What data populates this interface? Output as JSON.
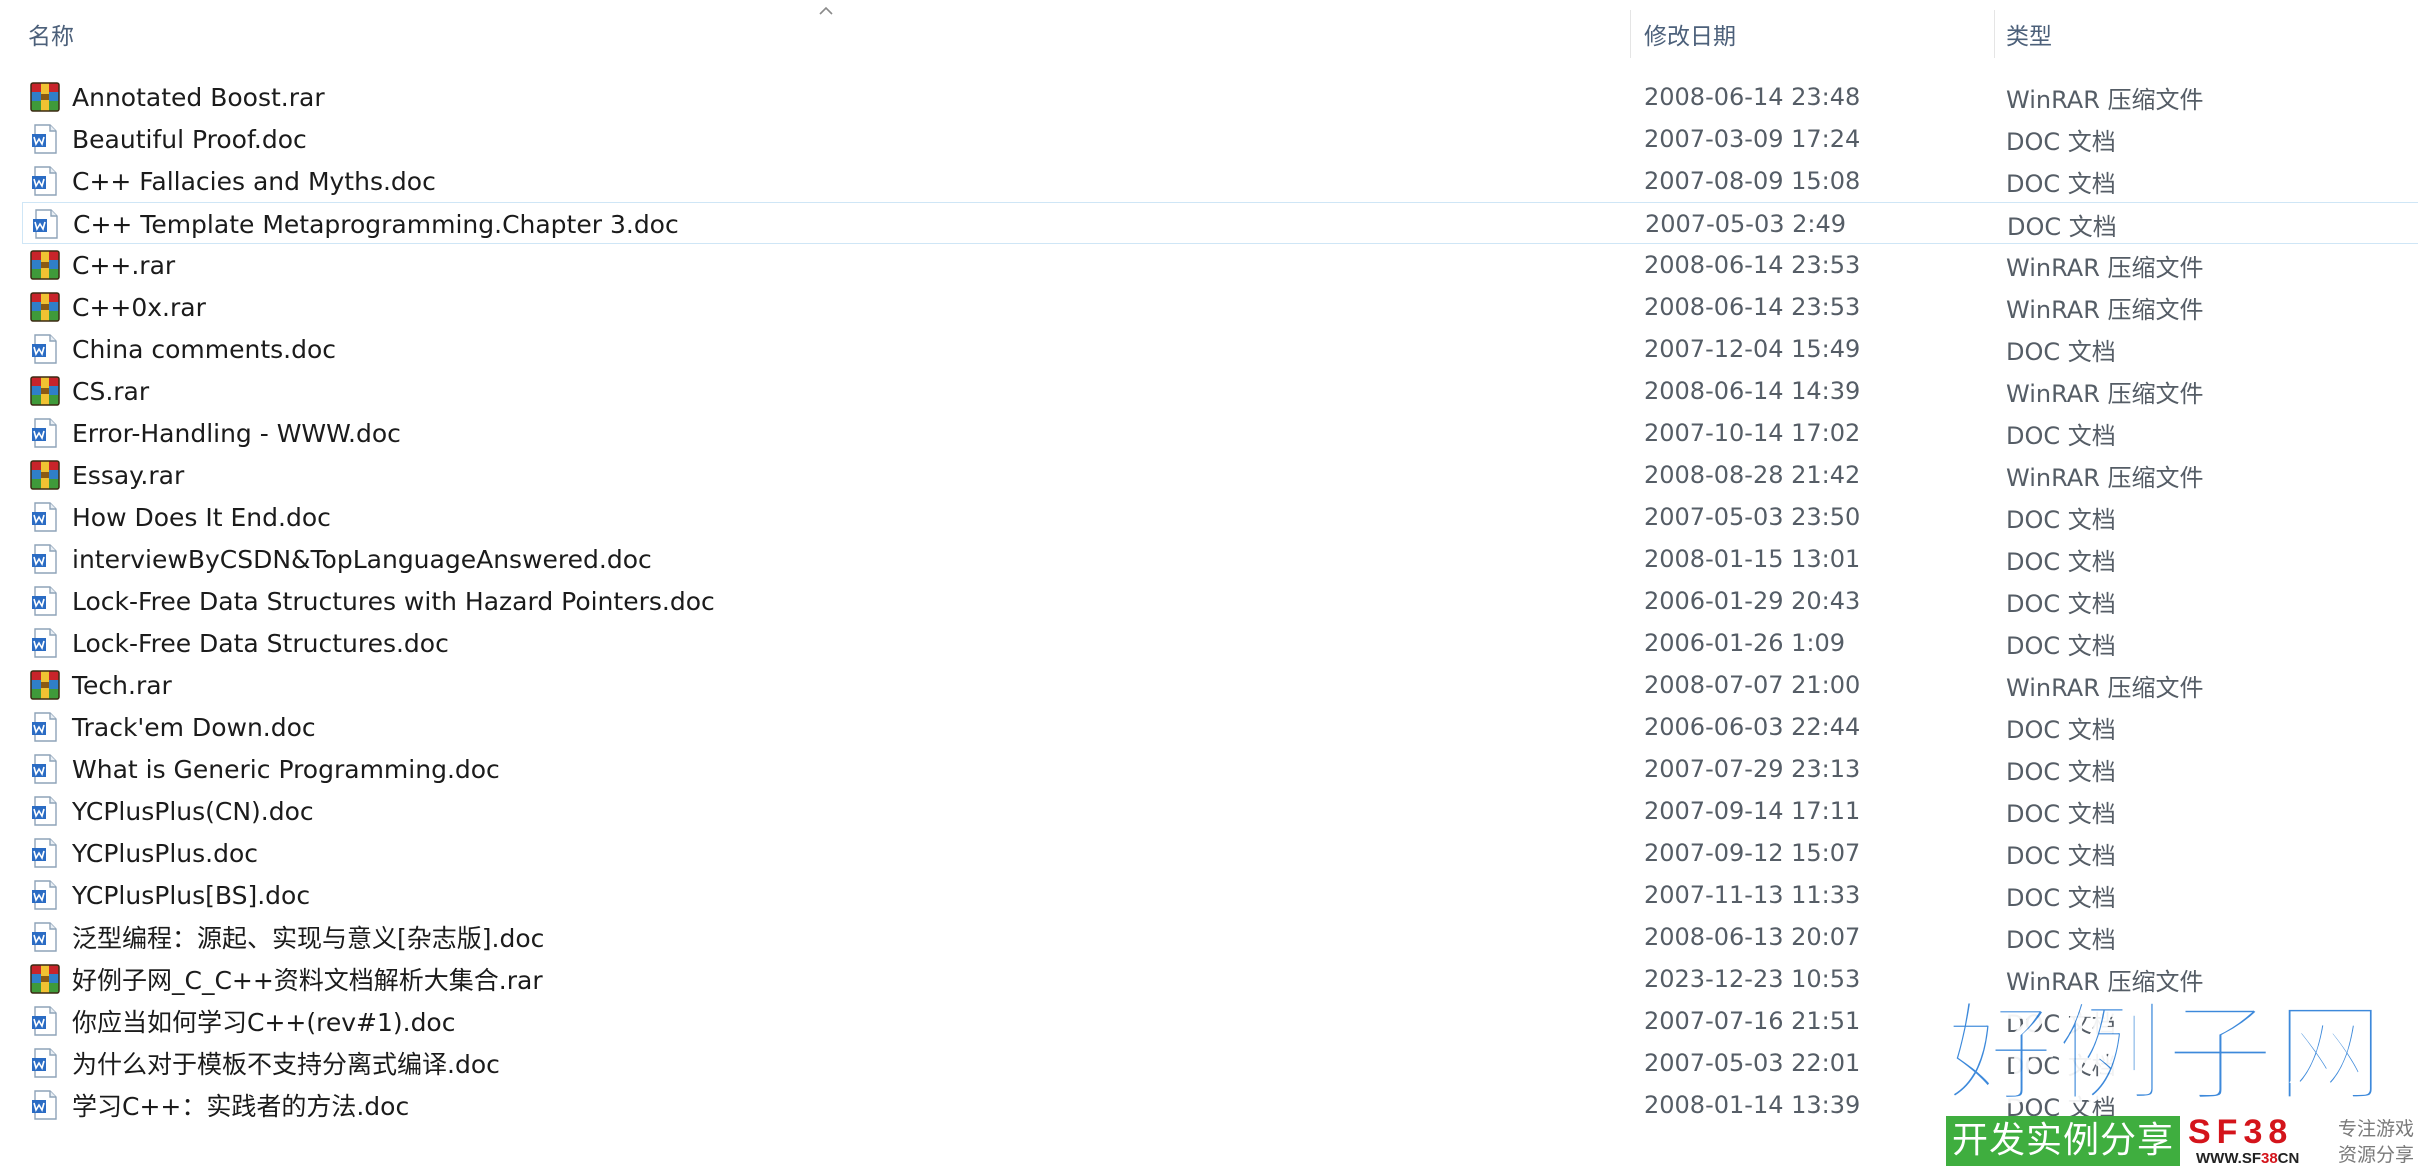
{
  "columns": {
    "name": "名称",
    "date": "修改日期",
    "type": "类型"
  },
  "files": [
    {
      "name": "Annotated Boost.rar",
      "date": "2008-06-14 23:48",
      "type": "WinRAR 压缩文件",
      "icon": "winrar-archive-icon"
    },
    {
      "name": "Beautiful Proof.doc",
      "date": "2007-03-09 17:24",
      "type": "DOC 文档",
      "icon": "word-document-icon"
    },
    {
      "name": "C++ Fallacies and Myths.doc",
      "date": "2007-08-09 15:08",
      "type": "DOC 文档",
      "icon": "word-document-icon"
    },
    {
      "name": "C++ Template Metaprogramming.Chapter 3.doc",
      "date": "2007-05-03 2:49",
      "type": "DOC 文档",
      "icon": "word-document-icon"
    },
    {
      "name": "C++.rar",
      "date": "2008-06-14 23:53",
      "type": "WinRAR 压缩文件",
      "icon": "winrar-archive-icon"
    },
    {
      "name": "C++0x.rar",
      "date": "2008-06-14 23:53",
      "type": "WinRAR 压缩文件",
      "icon": "winrar-archive-icon"
    },
    {
      "name": "China comments.doc",
      "date": "2007-12-04 15:49",
      "type": "DOC 文档",
      "icon": "word-document-icon"
    },
    {
      "name": "CS.rar",
      "date": "2008-06-14 14:39",
      "type": "WinRAR 压缩文件",
      "icon": "winrar-archive-icon"
    },
    {
      "name": "Error-Handling - WWW.doc",
      "date": "2007-10-14 17:02",
      "type": "DOC 文档",
      "icon": "word-document-icon"
    },
    {
      "name": "Essay.rar",
      "date": "2008-08-28 21:42",
      "type": "WinRAR 压缩文件",
      "icon": "winrar-archive-icon"
    },
    {
      "name": "How Does It End.doc",
      "date": "2007-05-03 23:50",
      "type": "DOC 文档",
      "icon": "word-document-icon"
    },
    {
      "name": "interviewByCSDN&TopLanguageAnswered.doc",
      "date": "2008-01-15 13:01",
      "type": "DOC 文档",
      "icon": "word-document-icon"
    },
    {
      "name": "Lock-Free Data Structures with Hazard Pointers.doc",
      "date": "2006-01-29 20:43",
      "type": "DOC 文档",
      "icon": "word-document-icon"
    },
    {
      "name": "Lock-Free Data Structures.doc",
      "date": "2006-01-26 1:09",
      "type": "DOC 文档",
      "icon": "word-document-icon"
    },
    {
      "name": "Tech.rar",
      "date": "2008-07-07 21:00",
      "type": "WinRAR 压缩文件",
      "icon": "winrar-archive-icon"
    },
    {
      "name": "Track'em Down.doc",
      "date": "2006-06-03 22:44",
      "type": "DOC 文档",
      "icon": "word-document-icon"
    },
    {
      "name": "What is Generic Programming.doc",
      "date": "2007-07-29 23:13",
      "type": "DOC 文档",
      "icon": "word-document-icon"
    },
    {
      "name": "YCPlusPlus(CN).doc",
      "date": "2007-09-14 17:11",
      "type": "DOC 文档",
      "icon": "word-document-icon"
    },
    {
      "name": "YCPlusPlus.doc",
      "date": "2007-09-12 15:07",
      "type": "DOC 文档",
      "icon": "word-document-icon"
    },
    {
      "name": "YCPlusPlus[BS].doc",
      "date": "2007-11-13 11:33",
      "type": "DOC 文档",
      "icon": "word-document-icon"
    },
    {
      "name": "泛型编程：源起、实现与意义[杂志版].doc",
      "date": "2008-06-13 20:07",
      "type": "DOC 文档",
      "icon": "word-document-icon"
    },
    {
      "name": "好例子网_C_C++资料文档解析大集合.rar",
      "date": "2023-12-23 10:53",
      "type": "WinRAR 压缩文件",
      "icon": "winrar-archive-icon"
    },
    {
      "name": "你应当如何学习C++(rev#1).doc",
      "date": "2007-07-16 21:51",
      "type": "DOC 文档",
      "icon": "word-document-icon"
    },
    {
      "name": "为什么对于模板不支持分离式编译.doc",
      "date": "2007-05-03 22:01",
      "type": "DOC 文档",
      "icon": "word-document-icon"
    },
    {
      "name": "学习C++：实践者的方法.doc",
      "date": "2008-01-14 13:39",
      "type": "DOC 文档",
      "icon": "word-document-icon"
    }
  ],
  "focused_row": 3,
  "watermark": {
    "brand": "好例子网",
    "slogan": "开发实例分享",
    "logo": "SF38",
    "url_prefix": "WWW.SF",
    "url_highlight": "38",
    "url_suffix": "CN",
    "tag_line1": "专注游戏",
    "tag_line2": "资源分享"
  }
}
